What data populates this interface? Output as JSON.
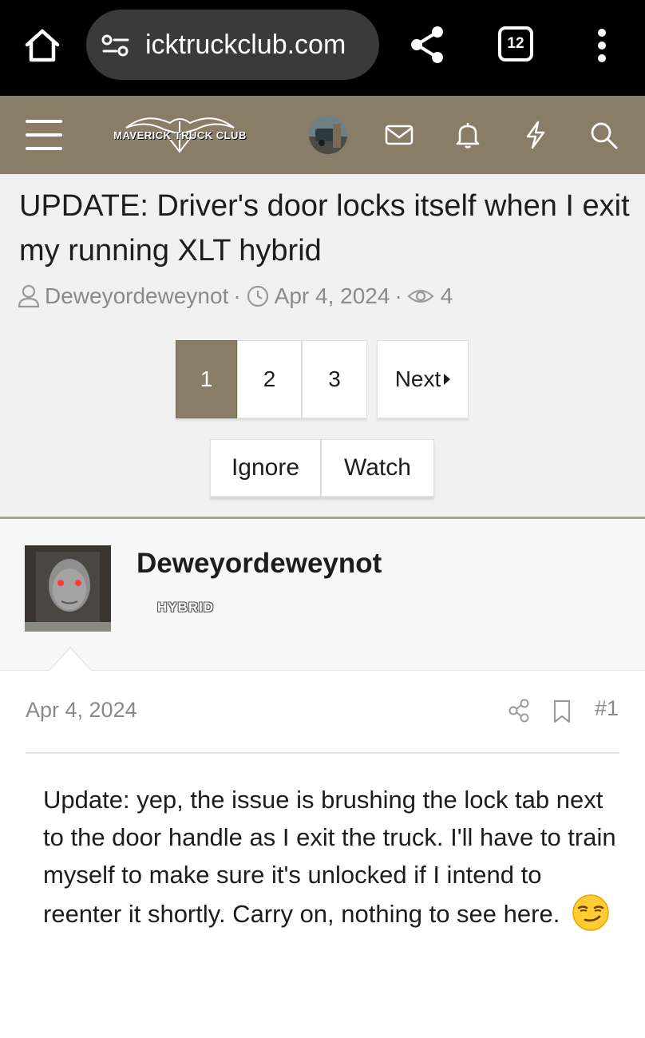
{
  "browser": {
    "url": "icktruckclub.com",
    "tab_count": "12"
  },
  "site": {
    "logo_text": "MAVERICK TRUCK CLUB"
  },
  "thread": {
    "title": "UPDATE: Driver's door locks itself when I exit my running XLT hybrid",
    "author": "Deweyordeweynot",
    "date": "Apr 4, 2024",
    "views": "4",
    "separator": "·"
  },
  "pagination": {
    "pages": [
      "1",
      "2",
      "3"
    ],
    "current_page": "1",
    "next_label": "Next"
  },
  "actions": {
    "ignore_label": "Ignore",
    "watch_label": "Watch"
  },
  "post": {
    "username": "Deweyordeweynot",
    "badge": "HYBRID",
    "date": "Apr 4, 2024",
    "number": "#1",
    "body": "Update: yep, the issue is brushing the lock tab next to the door handle as I exit the truck. I'll have to train myself to make sure it's unlocked if I intend to reenter it shortly. Carry on, nothing to see here.",
    "emoji": "smirking-face-icon"
  },
  "colors": {
    "brand": "#8a7d68",
    "browser_bar": "#000000",
    "url_pill": "#3a3a3a",
    "meta_text": "#8a8a8a"
  }
}
